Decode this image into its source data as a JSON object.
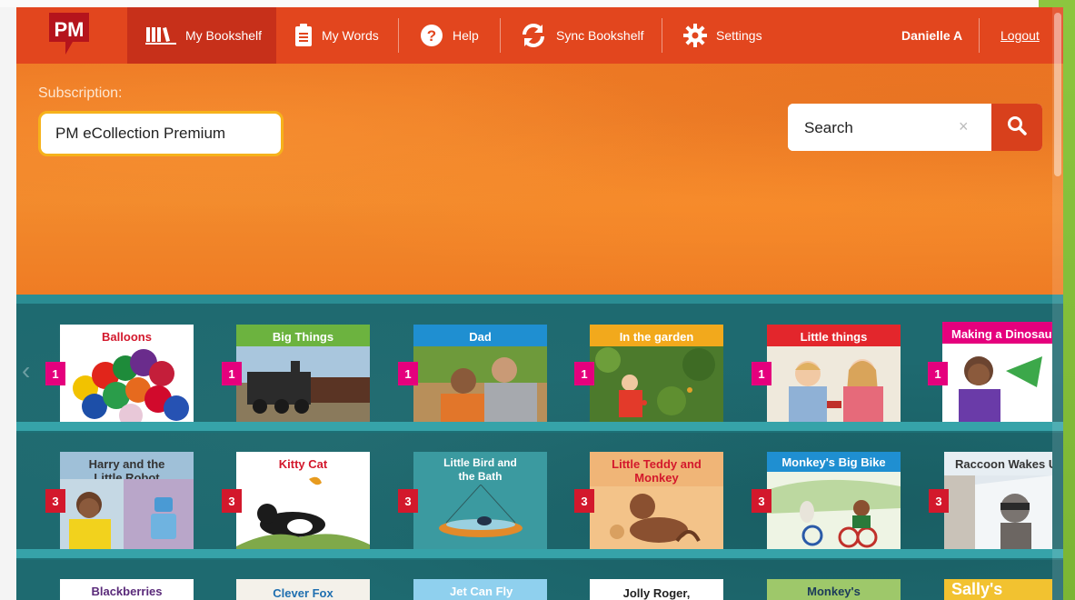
{
  "nav": {
    "logo": "PM",
    "items": [
      {
        "label": "My Bookshelf",
        "icon": "books-icon"
      },
      {
        "label": "My Words",
        "icon": "clipboard-icon"
      },
      {
        "label": "Help",
        "icon": "question-icon"
      },
      {
        "label": "Sync Bookshelf",
        "icon": "sync-icon"
      },
      {
        "label": "Settings",
        "icon": "gear-icon"
      }
    ],
    "user": "Danielle A",
    "logout": "Logout"
  },
  "subscription": {
    "label": "Subscription:",
    "value": "PM eCollection Premium"
  },
  "search": {
    "placeholder": "Search",
    "clear": "×"
  },
  "shelves": [
    {
      "books": [
        {
          "title": "Balloons",
          "level": "1"
        },
        {
          "title": "Big Things",
          "level": "1"
        },
        {
          "title": "Dad",
          "level": "1"
        },
        {
          "title": "In the garden",
          "level": "1"
        },
        {
          "title": "Little things",
          "level": "1"
        },
        {
          "title": "Making a Dinosaur",
          "level": "1"
        }
      ]
    },
    {
      "books": [
        {
          "title": "Harry and the Little Robot",
          "level": "3"
        },
        {
          "title": "Kitty Cat",
          "level": "3"
        },
        {
          "title": "Little Bird and the Bath",
          "level": "3"
        },
        {
          "title": "Little Teddy and Monkey",
          "level": "3"
        },
        {
          "title": "Monkey's Big Bike",
          "level": "3"
        },
        {
          "title": "Raccoon Wakes Up",
          "level": "3"
        }
      ]
    },
    {
      "books": [
        {
          "title": "Blackberries"
        },
        {
          "title": "Clever Fox"
        },
        {
          "title": "Jet Can Fly"
        },
        {
          "title": "Jolly Roger,"
        },
        {
          "title": "Monkey's"
        },
        {
          "title": "Sally's"
        }
      ]
    }
  ],
  "colors": {
    "nav": "#e2461e",
    "nav_active": "#c7301a",
    "hero": "#ef7c24",
    "shelf": "#1e6a70",
    "level1": "#e5007d",
    "level3": "#d3182c"
  }
}
